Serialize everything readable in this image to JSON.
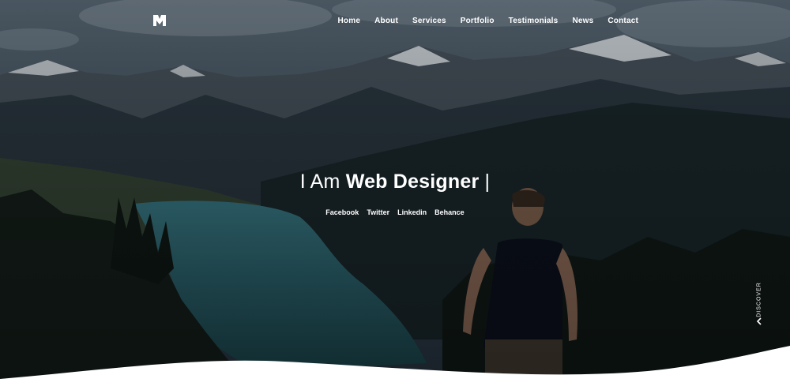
{
  "nav": {
    "logo_icon": "m-logo-icon",
    "items": [
      {
        "label": "Home"
      },
      {
        "label": "About"
      },
      {
        "label": "Services"
      },
      {
        "label": "Portfolio"
      },
      {
        "label": "Testimonials"
      },
      {
        "label": "News"
      },
      {
        "label": "Contact"
      }
    ]
  },
  "hero": {
    "headline_pre": "I Am ",
    "headline_strong": "Web Designer",
    "headline_cursor": " |",
    "background": "mountain-lake-hiker-photo"
  },
  "social": [
    {
      "label": "Facebook"
    },
    {
      "label": "Twitter"
    },
    {
      "label": "Linkedin"
    },
    {
      "label": "Behance"
    }
  ],
  "discover": {
    "label": "DISCOVER",
    "icon": "chevron-left-icon"
  },
  "colors": {
    "sky": "#3a4d5c",
    "lake": "#2f6f78",
    "forest": "#1a2a22",
    "text": "#ffffff"
  }
}
